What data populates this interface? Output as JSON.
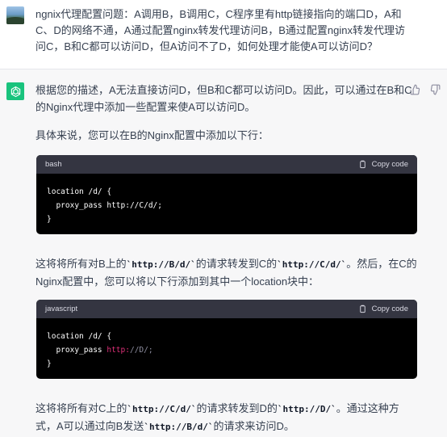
{
  "user": {
    "message": "ngnix代理配置问题：A调用B，B调用C，C程序里有http链接指向的端口D，A和C、D的网络不通，A通过配置nginx转发代理访问B，B通过配置nginx转发代理访问C，B和C都可以访问D，但A访问不了D，如何处理才能使A可以访问D？"
  },
  "assistant": {
    "p1": "根据您的描述，A无法直接访问D，但B和C都可以访问D。因此，可以通过在B和C的Nginx代理中添加一些配置来使A可以访问D。",
    "p2": "具体来说，您可以在B的Nginx配置中添加以下行：",
    "code1": {
      "lang": "bash",
      "copy_label": "Copy code",
      "line1": "location /d/ {",
      "line2_key": "  proxy_pass ",
      "line2_val": "http://C/d/;",
      "line3": "}"
    },
    "p3": {
      "t1": "这将将所有对B上的",
      "c1": "`http://B/d/`",
      "t2": "的请求转发到C的",
      "c2": "`http://C/d/`",
      "t3": "。然后，在C的Nginx配置中，您可以将以下行添加到其中一个location块中："
    },
    "code2": {
      "lang": "javascript",
      "copy_label": "Copy code",
      "line1": "location /d/ {",
      "line2_key": "  proxy_pass ",
      "line2_val": "http:",
      "line2_rest": "//D/;",
      "line3": "}"
    },
    "p4": {
      "t1": "这将将所有对C上的",
      "c1": "`http://C/d/`",
      "t2": "的请求转发到D的",
      "c2": "`http://D/`",
      "t3": "。通过这种方式，A可以通过向B发送",
      "c3": "`http://B/d/`",
      "t4": "的请求来访问D。"
    }
  },
  "icons": {
    "user_avatar": "landscape-avatar-icon",
    "assistant_avatar": "openai-logo-icon",
    "thumbs_up": "thumbs-up-icon",
    "thumbs_down": "thumbs-down-icon",
    "clipboard": "clipboard-icon"
  },
  "colors": {
    "assistant_bg": "#f7f7f8",
    "avatar_green": "#19c37d",
    "code_header": "#343541",
    "code_bg": "#000000",
    "string_pink": "#df3079"
  }
}
